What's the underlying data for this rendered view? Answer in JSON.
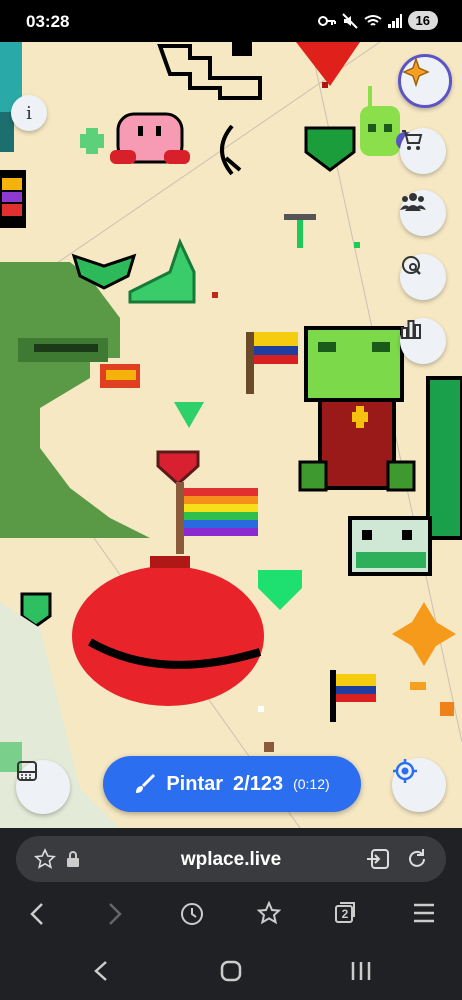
{
  "status_bar": {
    "time": "03:28",
    "battery": "16"
  },
  "map": {
    "background_color": "#f6e8c3",
    "level": "9"
  },
  "paint_button": {
    "label": "Pintar",
    "count": "2/123",
    "timer": "(0:12)",
    "color": "#2b6ef0"
  },
  "browser": {
    "url": "wplace.live",
    "tab_count": "2"
  },
  "icons": {
    "info": "i",
    "store": "shopping-cart-icon",
    "community": "people-icon",
    "search": "globe-search-icon",
    "stats": "bar-chart-icon",
    "palette": "palette-icon",
    "locate": "crosshair-icon"
  }
}
